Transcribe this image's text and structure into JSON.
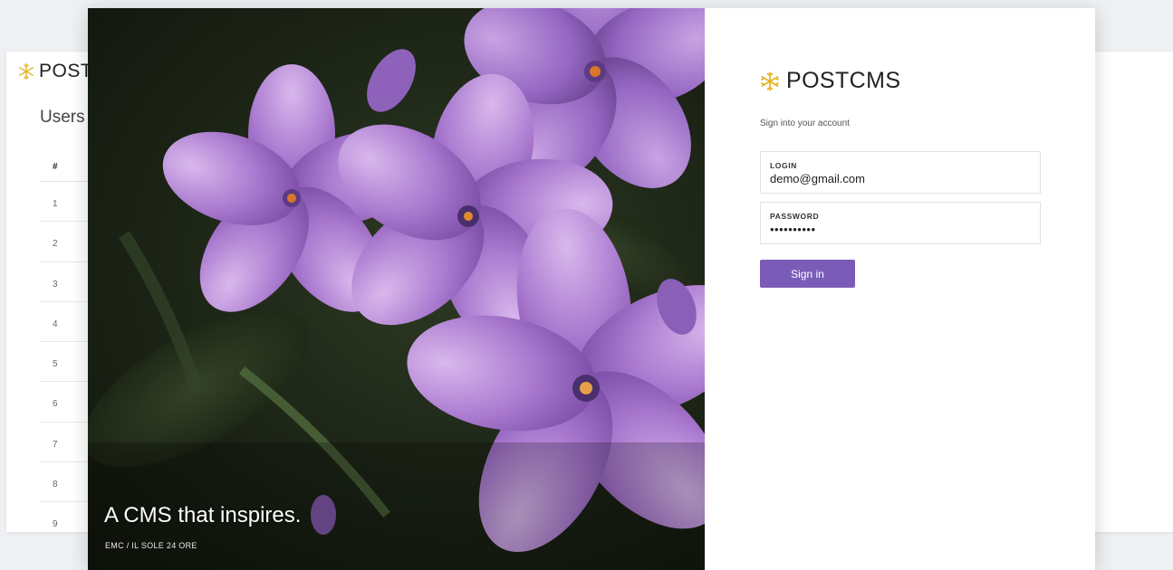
{
  "background_app": {
    "logo_text": "POSTCMS",
    "logo_icon": "snowflake-icon",
    "page_title": "Users",
    "table": {
      "header": "#",
      "rows": [
        "1",
        "2",
        "3",
        "4",
        "5",
        "6",
        "7",
        "8",
        "9"
      ]
    }
  },
  "hero": {
    "caption": "A CMS that inspires.",
    "credit": "EMC / IL SOLE 24 ORE"
  },
  "login": {
    "logo_text": "POSTCMS",
    "logo_icon": "snowflake-icon",
    "subtitle": "Sign into your account",
    "login_label": "LOGIN",
    "login_value": "demo@gmail.com",
    "password_label": "PASSWORD",
    "password_value": "••••••••••",
    "submit_label": "Sign in"
  },
  "colors": {
    "accent": "#7a5cb8",
    "logo_gold": "#e3b21c",
    "page_background": "#eef0f3"
  }
}
